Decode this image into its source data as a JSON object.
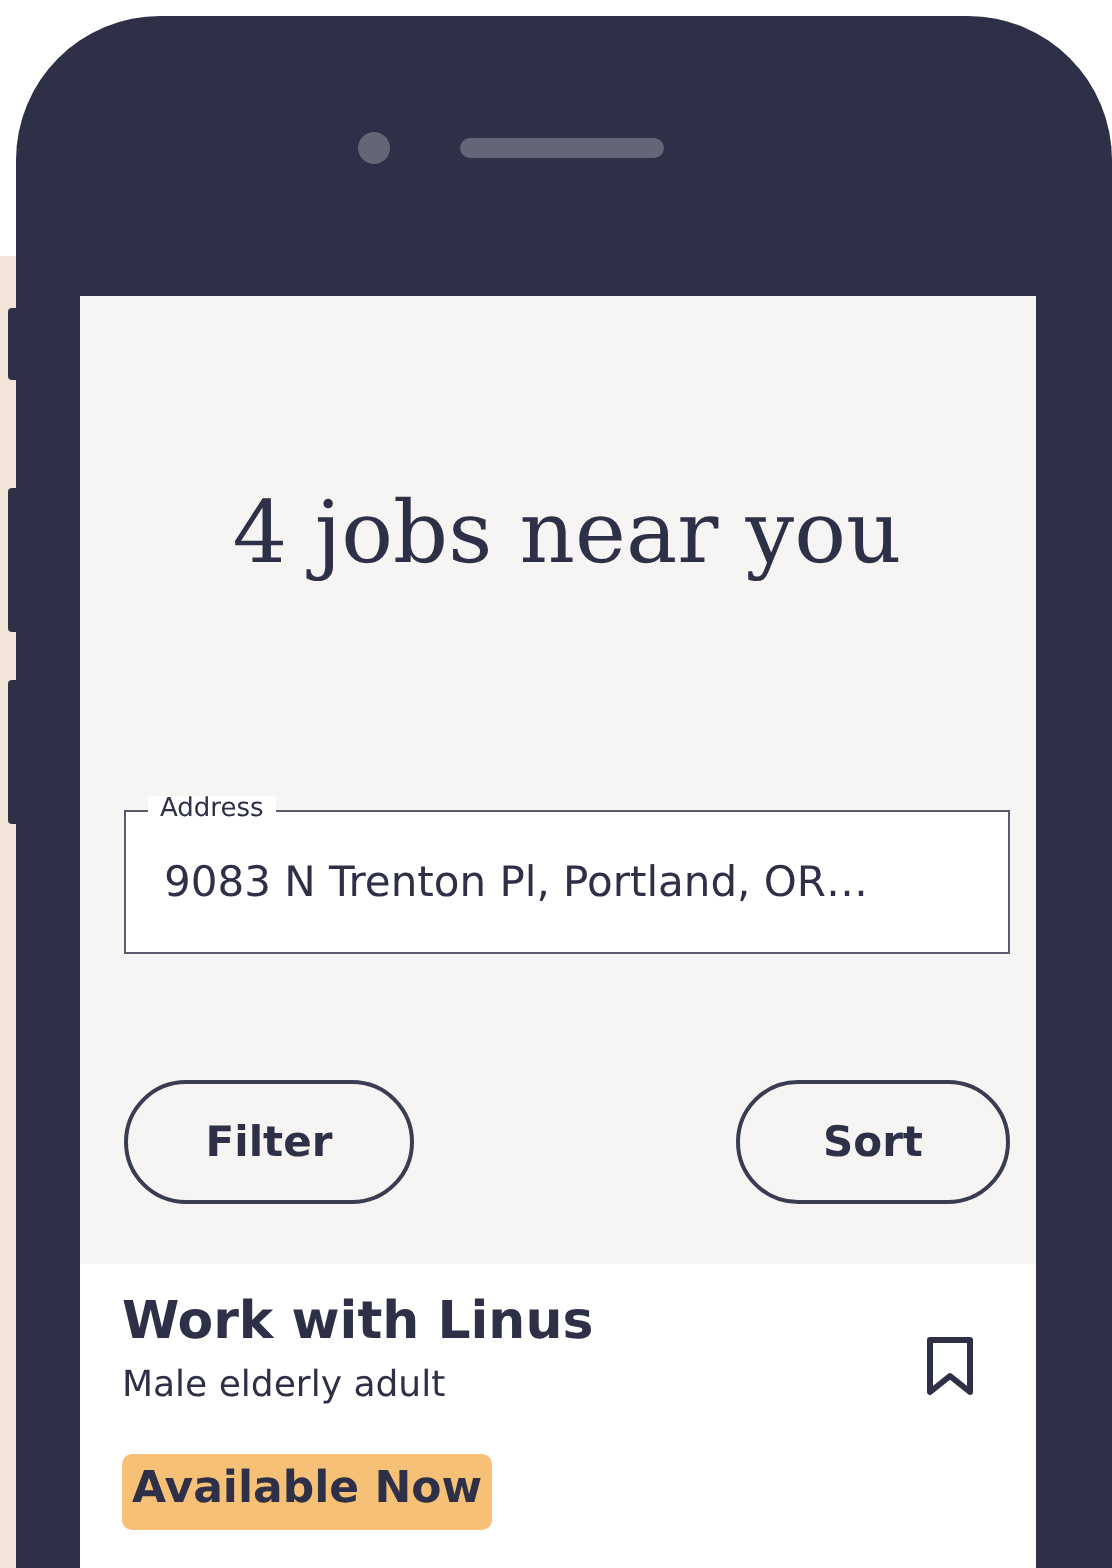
{
  "header": {
    "title": "4 jobs near you"
  },
  "address_field": {
    "label": "Address",
    "value": "9083 N Trenton Pl, Portland, OR…"
  },
  "buttons": [
    {
      "label": "Filter"
    },
    {
      "label": "Sort"
    }
  ],
  "jobs": [
    {
      "title": "Work with Linus",
      "subtitle": "Male elderly adult",
      "saved": false,
      "badge": "Available Now"
    }
  ]
}
